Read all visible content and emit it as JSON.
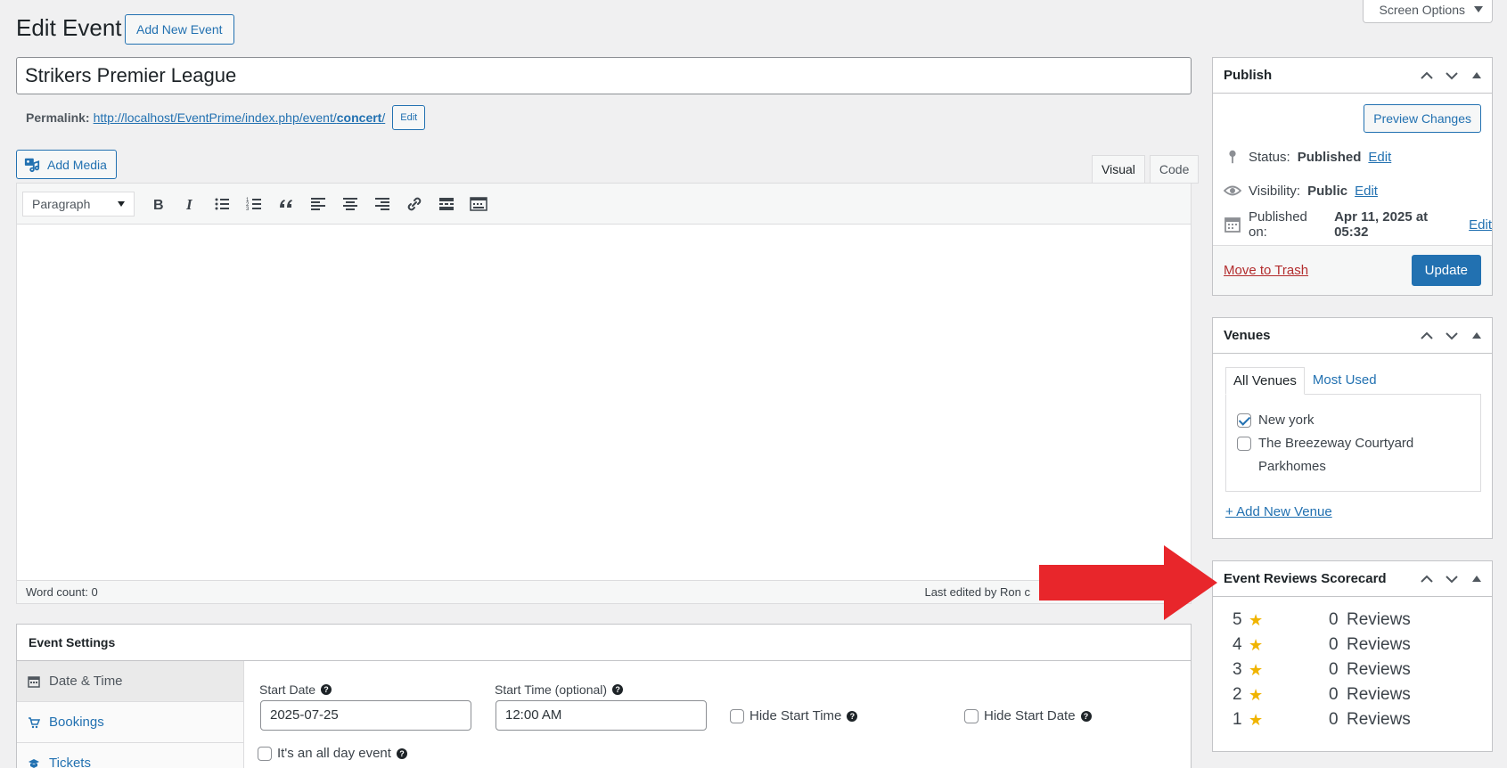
{
  "header": {
    "page_title": "Edit Event",
    "add_new_label": "Add New Event",
    "screen_options_label": "Screen Options"
  },
  "post": {
    "title": "Strikers Premier League",
    "permalink_label": "Permalink:",
    "permalink_base": "http://localhost/EventPrime/index.php/event/",
    "permalink_slug": "concert",
    "permalink_trailing": "/",
    "permalink_edit_label": "Edit"
  },
  "editor": {
    "add_media_label": "Add Media",
    "tabs": [
      "Visual",
      "Code"
    ],
    "active_tab": "Visual",
    "format_value": "Paragraph",
    "toolbar_icons": [
      "bold-icon",
      "italic-icon",
      "bulleted-list-icon",
      "numbered-list-icon",
      "blockquote-icon",
      "align-left-icon",
      "align-center-icon",
      "align-right-icon",
      "link-icon",
      "read-more-icon",
      "toolbar-toggle-icon"
    ],
    "word_count": "Word count: 0",
    "last_edited": "Last edited by Ron c"
  },
  "event_settings": {
    "title": "Event Settings",
    "nav": [
      {
        "label": "Date & Time",
        "icon": "calendar-icon"
      },
      {
        "label": "Bookings",
        "icon": "cart-icon"
      },
      {
        "label": "Tickets",
        "icon": "ticket-icon"
      }
    ],
    "start_date_label": "Start Date",
    "start_date_value": "2025-07-25",
    "start_time_label": "Start Time (optional)",
    "start_time_value": "12:00 AM",
    "hide_start_time_label": "Hide Start Time",
    "hide_start_date_label": "Hide Start Date",
    "all_day_label": "It's an all day event"
  },
  "publish": {
    "title": "Publish",
    "preview_label": "Preview Changes",
    "status_label": "Status:",
    "status_value": "Published",
    "visibility_label": "Visibility:",
    "visibility_value": "Public",
    "published_label": "Published on:",
    "published_value": "Apr 11, 2025 at 05:32",
    "edit_label": "Edit",
    "trash_label": "Move to Trash",
    "update_label": "Update"
  },
  "venues": {
    "title": "Venues",
    "tabs": [
      "All Venues",
      "Most Used"
    ],
    "items": [
      {
        "label": "New york",
        "checked": true
      },
      {
        "label": "The Breezeway Courtyard Parkhomes",
        "checked": false
      }
    ],
    "add_label": "+ Add New Venue"
  },
  "scorecard": {
    "title": "Event Reviews Scorecard",
    "star_glyph": "★",
    "rows": [
      {
        "stars": "5",
        "count": "0",
        "label": "Reviews"
      },
      {
        "stars": "4",
        "count": "0",
        "label": "Reviews"
      },
      {
        "stars": "3",
        "count": "0",
        "label": "Reviews"
      },
      {
        "stars": "2",
        "count": "0",
        "label": "Reviews"
      },
      {
        "stars": "1",
        "count": "0",
        "label": "Reviews"
      }
    ]
  },
  "colors": {
    "accent": "#2271b1",
    "danger": "#b32d2e",
    "annotation_arrow": "#e8262b",
    "star": "#f0b400"
  }
}
